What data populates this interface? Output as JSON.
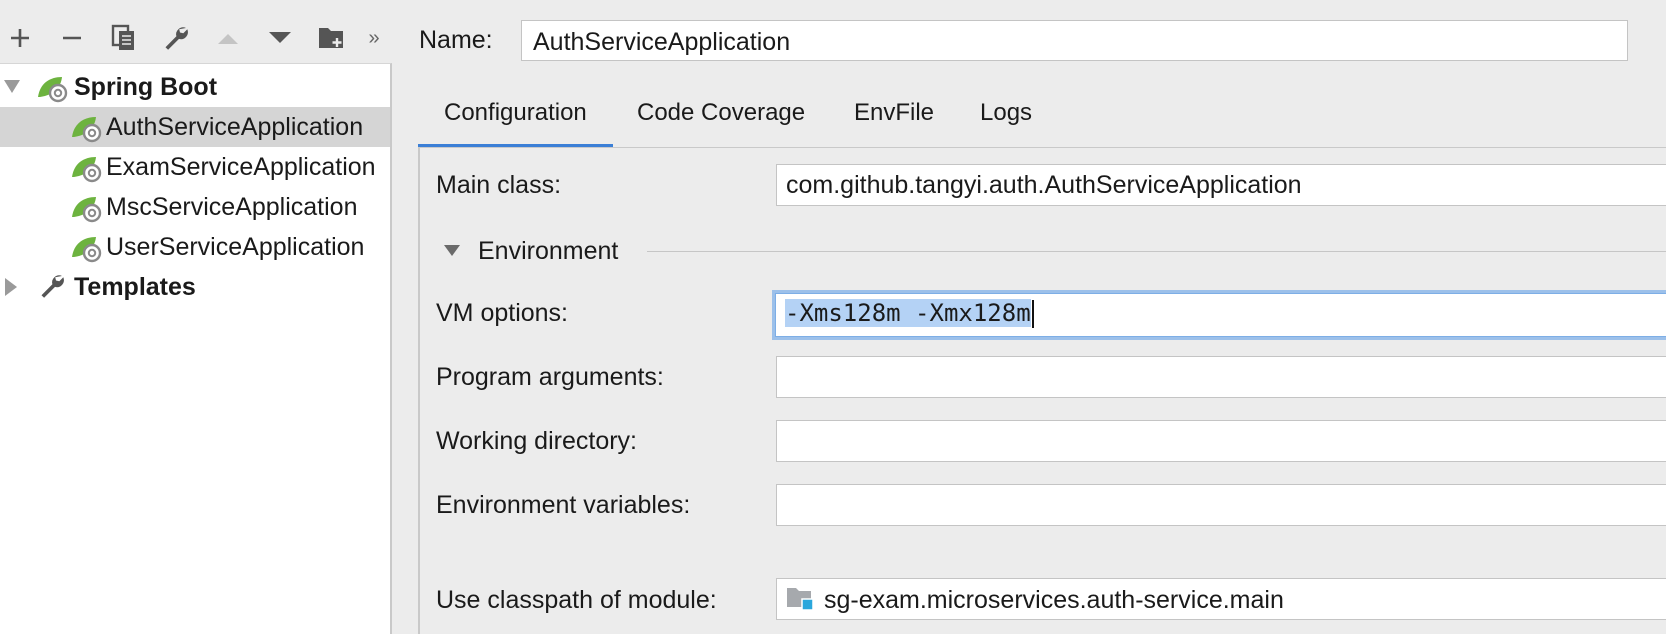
{
  "toolbar": {
    "buttons": [
      {
        "icon": "plus-icon"
      },
      {
        "icon": "minus-icon"
      },
      {
        "icon": "copy-icon"
      },
      {
        "icon": "wrench-icon"
      },
      {
        "icon": "move-up-icon"
      },
      {
        "icon": "move-down-icon"
      },
      {
        "icon": "new-folder-icon"
      },
      {
        "icon": "more-chevron-icon"
      }
    ],
    "more_glyph": "»"
  },
  "tree": {
    "groups": [
      {
        "label": "Spring Boot",
        "expanded": true,
        "icon": "spring-boot-icon",
        "items": [
          {
            "label": "AuthServiceApplication",
            "selected": true
          },
          {
            "label": "ExamServiceApplication",
            "selected": false
          },
          {
            "label": "MscServiceApplication",
            "selected": false
          },
          {
            "label": "UserServiceApplication",
            "selected": false
          }
        ]
      },
      {
        "label": "Templates",
        "expanded": false,
        "icon": "wrench-icon",
        "items": []
      }
    ]
  },
  "config": {
    "name_label": "Name:",
    "name_value": "AuthServiceApplication",
    "tabs": [
      {
        "label": "Configuration",
        "active": true
      },
      {
        "label": "Code Coverage",
        "active": false
      },
      {
        "label": "EnvFile",
        "active": false
      },
      {
        "label": "Logs",
        "active": false
      }
    ],
    "main_class": {
      "label": "Main class:",
      "value": "com.github.tangyi.auth.AuthServiceApplication"
    },
    "environment_section": {
      "label": "Environment",
      "expanded": true
    },
    "vm_options": {
      "label": "VM options:",
      "value": "-Xms128m -Xmx128m"
    },
    "program_arguments": {
      "label": "Program arguments:",
      "value": ""
    },
    "working_directory": {
      "label": "Working directory:",
      "value": ""
    },
    "environment_variables": {
      "label": "Environment variables:",
      "value": ""
    },
    "classpath_module": {
      "label": "Use classpath of module:",
      "value": "sg-exam.microservices.auth-service.main",
      "icon": "module-folder-icon"
    }
  },
  "colors": {
    "accent": "#3b7fd6",
    "selection": "#b4d2f5",
    "focus_ring": "#9cc0ea",
    "spring_green": "#6db33f",
    "tree_selected": "#d5d5d5",
    "panel_bg": "#ececec"
  }
}
